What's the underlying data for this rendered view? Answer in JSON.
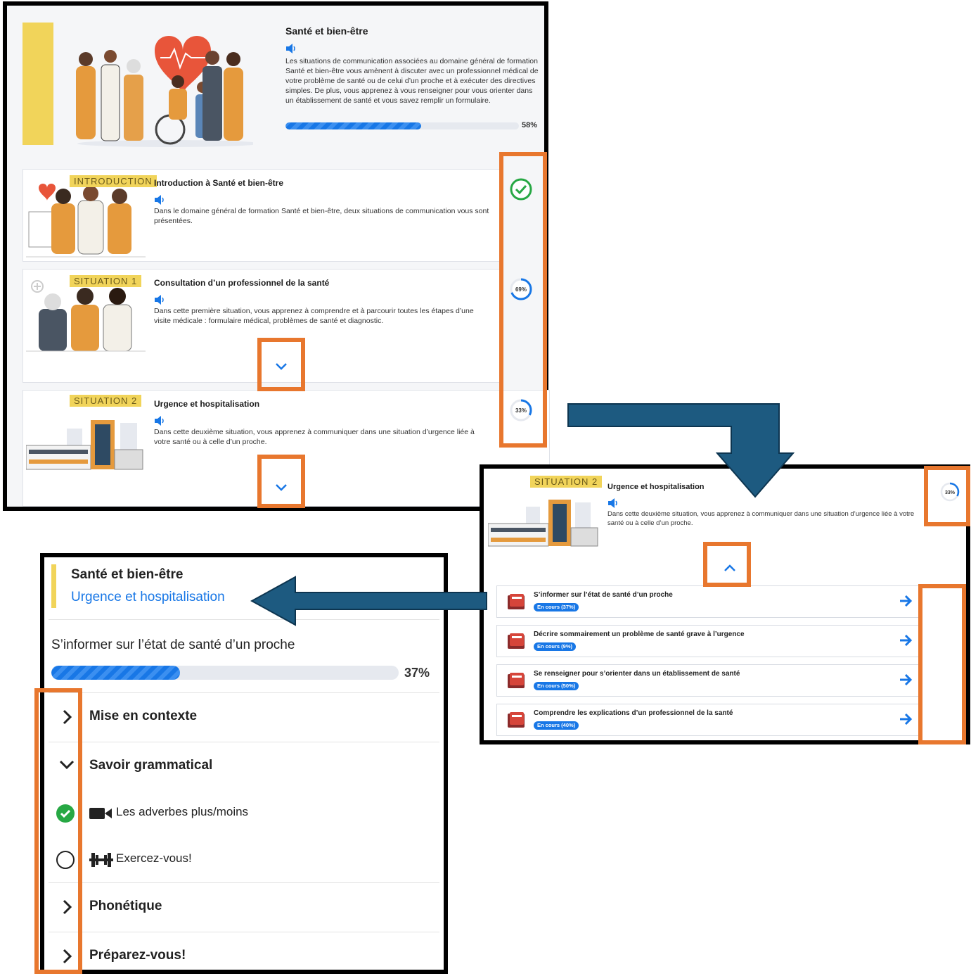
{
  "domain": {
    "title": "Santé et bien-être",
    "description": "Les situations de communication associées au domaine général de formation Santé et bien-être vous amènent à discuter avec un professionnel médical de votre problème de santé ou de celui d’un proche et à exécuter des directives simples. De plus, vous apprenez à vous renseigner pour vous orienter dans un établissement de santé et vous savez remplir un formulaire.",
    "progress_label": "58%",
    "progress": 0.58
  },
  "cards": [
    {
      "tag": "INTRODUCTION",
      "title": "Introduction à Santé et bien-être",
      "text": "Dans le domaine général de formation Santé et bien-être, deux situations de communication vous sont présentées.",
      "status": "complete"
    },
    {
      "tag": "SITUATION 1",
      "title": "Consultation d’un professionnel de la santé",
      "text": "Dans cette première situation, vous apprenez à comprendre et à parcourir toutes les étapes d’une visite médicale : formulaire médical, problèmes de santé et diagnostic.",
      "status": "69%",
      "progress": 0.69
    },
    {
      "tag": "SITUATION 2",
      "title": "Urgence et hospitalisation",
      "text": "Dans cette deuxième situation, vous apprenez à communiquer dans une situation d’urgence liée à votre santé ou à celle d’un proche.",
      "status": "33%",
      "progress": 0.33
    }
  ],
  "expanded": {
    "tag": "SITUATION 2",
    "title": "Urgence et hospitalisation",
    "text": "Dans cette deuxième situation, vous apprenez à communiquer dans une situation d’urgence liée à votre santé ou à celle d’un proche.",
    "status": "33%",
    "tasks": [
      {
        "title": "S’informer sur l’état de santé d’un proche",
        "badge": "En cours (37%)"
      },
      {
        "title": "Décrire sommairement un problème de santé grave à l’urgence",
        "badge": "En cours (9%)"
      },
      {
        "title": "Se renseigner pour s’orienter dans un établissement de santé",
        "badge": "En cours (50%)"
      },
      {
        "title": "Comprendre les explications d’un professionnel de la santé",
        "badge": "En cours (40%)"
      }
    ]
  },
  "detail": {
    "domain": "Santé et bien-être",
    "situation": "Urgence et hospitalisation",
    "task": "S’informer sur l’état de santé d’un proche",
    "progress_label": "37%",
    "progress": 0.37,
    "sections": [
      {
        "label": "Mise en contexte",
        "state": "collapsed"
      },
      {
        "label": "Savoir grammatical",
        "state": "expanded"
      },
      {
        "label": "Phonétique",
        "state": "collapsed"
      },
      {
        "label": "Préparez-vous!",
        "state": "collapsed"
      }
    ],
    "items": [
      {
        "label": "Les adverbes plus/moins",
        "icon": "video-icon",
        "done": true
      },
      {
        "label": "Exercez-vous!",
        "icon": "dumbbell-icon",
        "done": false
      }
    ]
  },
  "colors": {
    "accent_yellow": "#f1d45a",
    "highlight_orange": "#e8772e",
    "flow_arrow": "#1d5a80",
    "primary_blue": "#1877e6",
    "success_green": "#27a844"
  }
}
